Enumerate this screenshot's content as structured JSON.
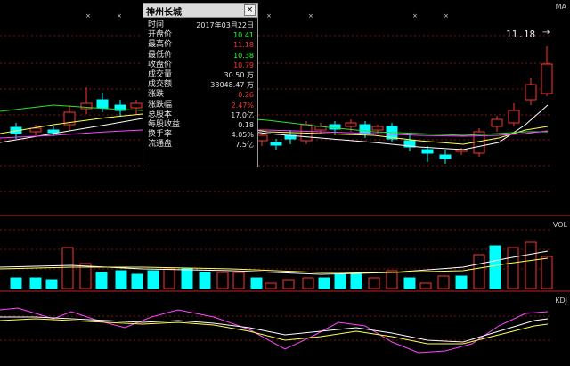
{
  "top_right_label": "MA",
  "vol_label": "VOL",
  "kdj_label": "KDJ",
  "high_marker": {
    "price": "11.18",
    "arrow": "→"
  },
  "close_marks": [
    "×",
    "×",
    "×",
    "×",
    "×",
    "×"
  ],
  "colors": {
    "up": "#ff3232",
    "down": "#00ffff",
    "grid": "#b01818",
    "ma5": "#ffffff",
    "ma10": "#ffff55",
    "ma20": "#ff44ff",
    "ma60": "#33dd33",
    "green_text": "#33ff33",
    "red_text": "#ff3333"
  },
  "info_panel": {
    "title": "神州长城",
    "rows": [
      {
        "label": "时间",
        "value": "2017年03月22日",
        "color": "#e0e0e0"
      },
      {
        "label": "开盘价",
        "value": "10.41",
        "color": "#33ff33"
      },
      {
        "label": "最高价",
        "value": "11.18",
        "color": "#ff3333"
      },
      {
        "label": "最低价",
        "value": "10.38",
        "color": "#33ff33"
      },
      {
        "label": "收盘价",
        "value": "10.79",
        "color": "#ff3333"
      },
      {
        "label": "成交量",
        "value": "30.50 万",
        "color": "#e0e0e0"
      },
      {
        "label": "成交额",
        "value": "33048.47 万",
        "color": "#e0e0e0"
      },
      {
        "label": "涨跌",
        "value": "0.26",
        "color": "#ff3333"
      },
      {
        "label": "涨跌幅",
        "value": "2.47%",
        "color": "#ff3333"
      },
      {
        "label": "总股本",
        "value": "17.0亿",
        "color": "#e0e0e0"
      },
      {
        "label": "每股收益",
        "value": "0.18",
        "color": "#e0e0e0"
      },
      {
        "label": "换手率",
        "value": "4.05%",
        "color": "#e0e0e0"
      },
      {
        "label": "流通盘",
        "value": "7.5亿",
        "color": "#e0e0e0"
      }
    ]
  }
}
